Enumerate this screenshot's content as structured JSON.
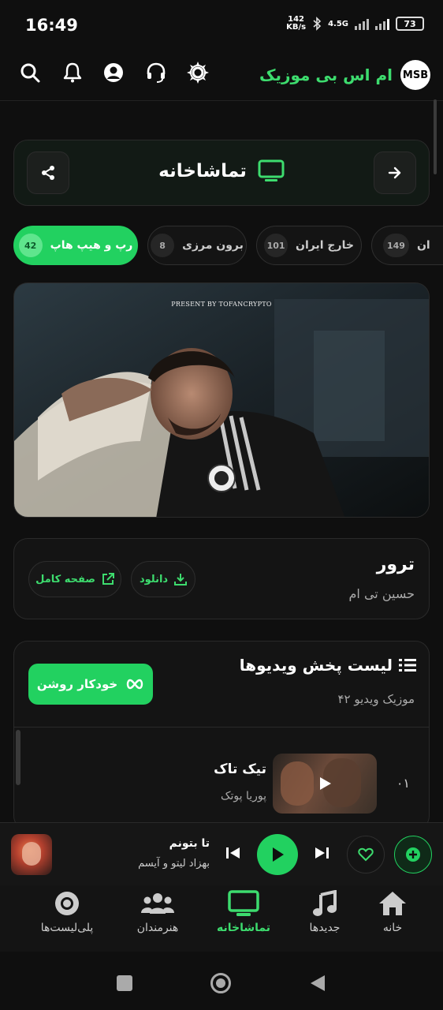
{
  "status_bar": {
    "time": "16:49",
    "net_speed_value": "142",
    "net_speed_unit": "KB/s",
    "network_type": "4.5G",
    "battery": "73"
  },
  "header": {
    "brand_name": "ام اس بی موزیک",
    "logo_text": "MSB",
    "icons": [
      "search-icon",
      "bell-icon",
      "user-icon",
      "headset-icon",
      "sun-icon"
    ]
  },
  "page": {
    "title": "تماشاخانه",
    "title_icon": "tv-icon"
  },
  "chips": [
    {
      "label": "رپ و هیپ هاپ",
      "count": "42",
      "active": true
    },
    {
      "label": "برون مرزی",
      "count": "8",
      "active": false
    },
    {
      "label": "خارج ایران",
      "count": "101",
      "active": false
    },
    {
      "label": "ان",
      "count": "149",
      "active": false
    }
  ],
  "video": {
    "caption": "PRESENT BY TOFANCRYPTO"
  },
  "track": {
    "title": "ترور",
    "artist": "حسین تی ام",
    "download_label": "دانلود",
    "full_page_label": "صفحه کامل"
  },
  "playlist": {
    "title": "لیست پخش ویدیوها",
    "subtitle": "۴۲ موزیک ویدیو",
    "autoplay_label": "خودکار روشن",
    "rows": [
      {
        "num": "۰۱",
        "title": "تیک تاک",
        "artist": "پوریا پوتک"
      }
    ]
  },
  "mini_player": {
    "title": "تا بتونم",
    "artist": "بهزاد لیتو و آیسم"
  },
  "bottom_nav": [
    {
      "label": "خانه",
      "icon": "home-icon",
      "active": false
    },
    {
      "label": "جدیدها",
      "icon": "music-note-icon",
      "active": false
    },
    {
      "label": "تماشاخانه",
      "icon": "tv-icon",
      "active": true
    },
    {
      "label": "هنرمندان",
      "icon": "users-icon",
      "active": false
    },
    {
      "label": "پلی‌لیست‌ها",
      "icon": "disc-icon",
      "active": false
    }
  ],
  "colors": {
    "accent": "#22d160",
    "accent_text": "#3ddc6e",
    "background": "#0f0f0f",
    "card": "#141414"
  }
}
